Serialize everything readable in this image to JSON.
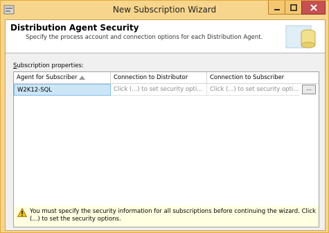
{
  "window": {
    "title": "New Subscription Wizard",
    "controls": {
      "minimize": "minimize",
      "maximize": "maximize",
      "close": "close"
    }
  },
  "header": {
    "title": "Distribution Agent Security",
    "description": "Specify the process account and connection options for each Distribution Agent."
  },
  "props": {
    "label_first": "S",
    "label_rest": "ubscription properties:"
  },
  "grid": {
    "columns": [
      "Agent for Subscriber",
      "Connection to Distributor",
      "Connection to Subscriber"
    ],
    "rows": [
      {
        "agent": "W2K12-SQL",
        "distributor": "Click (...) to set security opti...",
        "subscriber": "Click (...) to set security opti...",
        "button": "..."
      }
    ]
  },
  "message": {
    "text": "You must specify the security information for all subscriptions before continuing the wizard. Click (...) to set the security options."
  },
  "colors": {
    "frame": "#f7d58c",
    "close": "#c75050",
    "selection": "#cde6f7",
    "message_bg": "#ffffe1"
  }
}
